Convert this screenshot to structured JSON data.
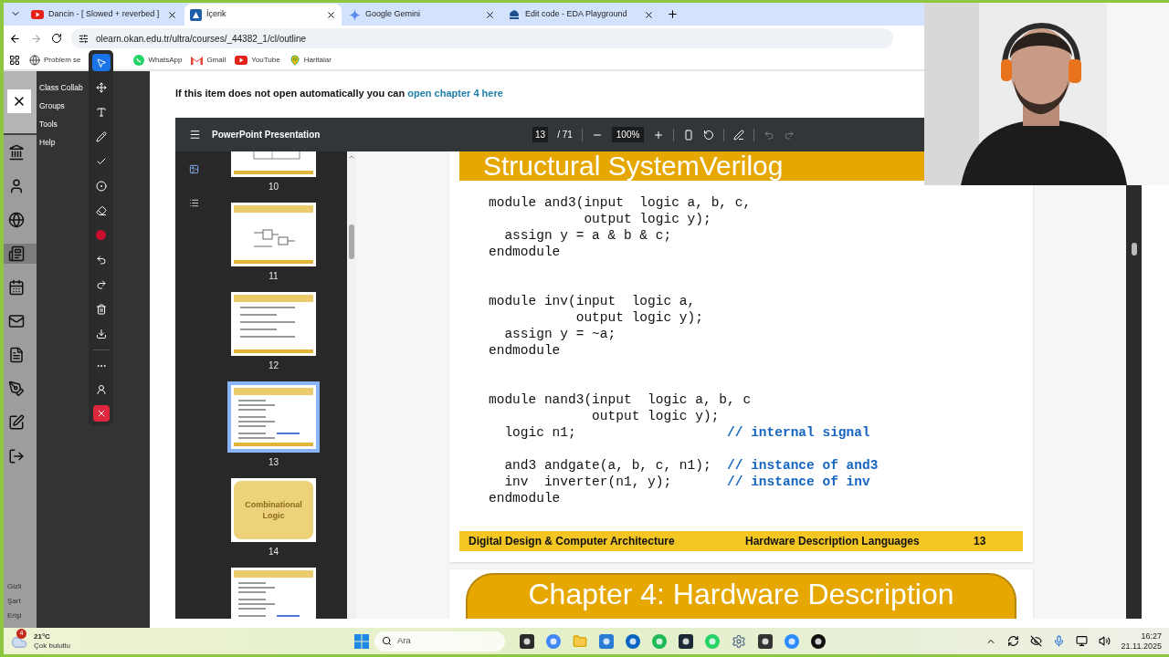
{
  "browser": {
    "tabs": [
      {
        "kind": "video",
        "title": "Dancin - [ Slowed + reverbed ]",
        "selected": false
      },
      {
        "kind": "course",
        "title": "İçerik",
        "selected": true
      },
      {
        "kind": "star",
        "title": "Google Gemini",
        "selected": false
      },
      {
        "kind": "cloud",
        "title": "Edit code - EDA Playground",
        "selected": false
      }
    ],
    "url": "olearn.okan.edu.tr/ultra/courses/_44382_1/cl/outline",
    "bookmarks": [
      {
        "kind": "globe",
        "label": "Problem se"
      },
      {
        "kind": "chat",
        "label": "WhatsApp"
      },
      {
        "kind": "mail",
        "label": "Gmail"
      },
      {
        "kind": "video",
        "label": "YouTube"
      },
      {
        "kind": "pin",
        "label": "Haritalar"
      }
    ]
  },
  "course_nav": {
    "rail": [
      {
        "kind": "institution",
        "selected": false
      },
      {
        "kind": "profile",
        "selected": false
      },
      {
        "kind": "globe",
        "selected": false
      },
      {
        "kind": "courses",
        "selected": true
      },
      {
        "kind": "calendar",
        "selected": false
      },
      {
        "kind": "messages",
        "selected": false
      },
      {
        "kind": "grades",
        "selected": false
      },
      {
        "kind": "tools",
        "selected": false
      },
      {
        "kind": "edit",
        "selected": false
      },
      {
        "kind": "logout",
        "selected": false
      }
    ],
    "menu": [
      "Class Collab",
      "Groups",
      "Tools",
      "Help"
    ],
    "footer_links": [
      "Gizli",
      "Şart",
      "Erişi"
    ]
  },
  "annotation_toolbar": {
    "tools": [
      {
        "kind": "pointer",
        "selected": true
      },
      {
        "kind": "move",
        "selected": false
      },
      {
        "kind": "text",
        "selected": false
      },
      {
        "kind": "pen",
        "selected": false
      },
      {
        "kind": "check",
        "selected": false
      },
      {
        "kind": "stamp",
        "selected": false
      },
      {
        "kind": "eraser",
        "selected": false
      },
      {
        "kind": "color",
        "selected": false,
        "color": "#c8102e"
      },
      {
        "kind": "undo",
        "selected": false
      },
      {
        "kind": "redo",
        "selected": false
      },
      {
        "kind": "trash",
        "selected": false
      },
      {
        "kind": "download",
        "selected": false
      }
    ],
    "extra_tools": [
      {
        "kind": "more"
      },
      {
        "kind": "user"
      },
      {
        "kind": "close"
      }
    ]
  },
  "banner": {
    "text": "If this item does not open automatically you can ",
    "link": "open chapter 4 here"
  },
  "viewer": {
    "title": "PowerPoint Presentation",
    "page": "13",
    "page_count": "/ 71",
    "zoom": "100%",
    "history": [
      {
        "kind": "undo",
        "disabled": true
      },
      {
        "kind": "redo",
        "disabled": true
      }
    ],
    "sidebar_tabs": [
      {
        "kind": "thumbnails",
        "selected": true
      },
      {
        "kind": "outline",
        "selected": false
      }
    ],
    "thumbnails": [
      {
        "kind": "table",
        "page": "10",
        "selected": false
      },
      {
        "kind": "circuit",
        "page": "11",
        "selected": false
      },
      {
        "kind": "bullets",
        "page": "12",
        "selected": false
      },
      {
        "kind": "code",
        "page": "13",
        "selected": true
      },
      {
        "kind": "title",
        "page": "14",
        "selected": false,
        "text": "Combinational Logic"
      },
      {
        "kind": "code",
        "selected": false
      }
    ],
    "slide": {
      "title": "Structural SystemVerilog",
      "lines": [
        {
          "kind": "code",
          "code": "module and3(input  logic a, b, c,"
        },
        {
          "kind": "code",
          "code": "            output logic y);"
        },
        {
          "kind": "code",
          "code": "  assign y = a & b & c;"
        },
        {
          "kind": "code",
          "code": "endmodule"
        },
        {
          "kind": "gap"
        },
        {
          "kind": "gap"
        },
        {
          "kind": "code",
          "code": "module inv(input  logic a,"
        },
        {
          "kind": "code",
          "code": "           output logic y);"
        },
        {
          "kind": "code",
          "code": "  assign y = ~a;"
        },
        {
          "kind": "code",
          "code": "endmodule"
        },
        {
          "kind": "gap"
        },
        {
          "kind": "gap"
        },
        {
          "kind": "code",
          "code": "module nand3(input  logic a, b, c"
        },
        {
          "kind": "code",
          "code": "             output logic y);"
        },
        {
          "kind": "code",
          "code": "  logic n1;                   ",
          "comment": "// internal signal"
        },
        {
          "kind": "gap"
        },
        {
          "kind": "code",
          "code": "  and3 andgate(a, b, c, n1);  ",
          "comment": "// instance of and3"
        },
        {
          "kind": "code",
          "code": "  inv  inverter(n1, y);       ",
          "comment": "// instance of inv"
        },
        {
          "kind": "code",
          "code": "endmodule"
        }
      ],
      "footer": {
        "left": "Digital Design & Computer Architecture",
        "right": "Hardware Description Languages",
        "number": "13"
      }
    },
    "next_slide": {
      "title": "Chapter 4: Hardware Description"
    }
  },
  "taskbar": {
    "weather": {
      "badge": "4",
      "temperature": "21°C",
      "condition": "Çok bulutlu"
    },
    "search": {
      "placeholder": "Ara"
    },
    "time": "16:27",
    "date": "21.11.2025"
  }
}
